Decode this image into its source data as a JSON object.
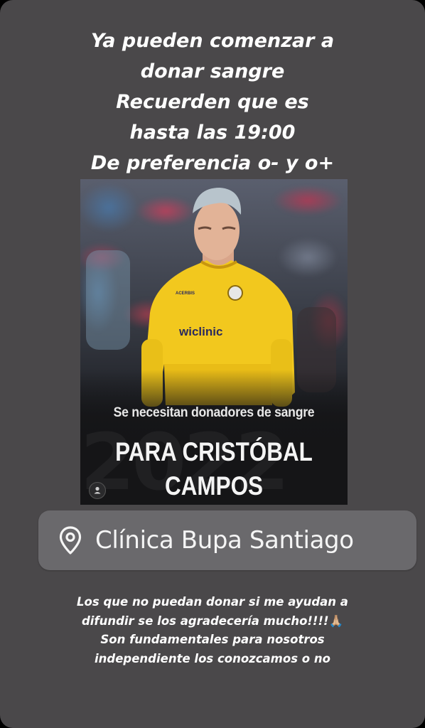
{
  "story": {
    "top_caption": [
      "Ya pueden comenzar a",
      "donar sangre",
      "Recuerden que es",
      "hasta las 19:00",
      "De preferencia o- y o+"
    ],
    "post": {
      "jersey_sponsor": "wiclinic",
      "jersey_brand": "ACERBIS",
      "headline_small": "Se necesitan donadores de sangre",
      "headline_big_line1": "PARA CRISTÓBAL",
      "headline_big_line2": "CAMPOS",
      "watermark": "2022"
    },
    "location_sticker": {
      "icon": "location-pin-icon",
      "label": "Clínica Bupa Santiago"
    },
    "bottom_caption": [
      "Los que no puedan donar si me ayudan a",
      "difundir se los agradecería mucho!!!!",
      "Son fundamentales para nosotros",
      "independiente los conozcamos o no"
    ],
    "bottom_emoji": "🙏🏼",
    "colors": {
      "background": "#4a484a",
      "sticker": "#6a696c",
      "jersey": "#f2c81e"
    }
  }
}
